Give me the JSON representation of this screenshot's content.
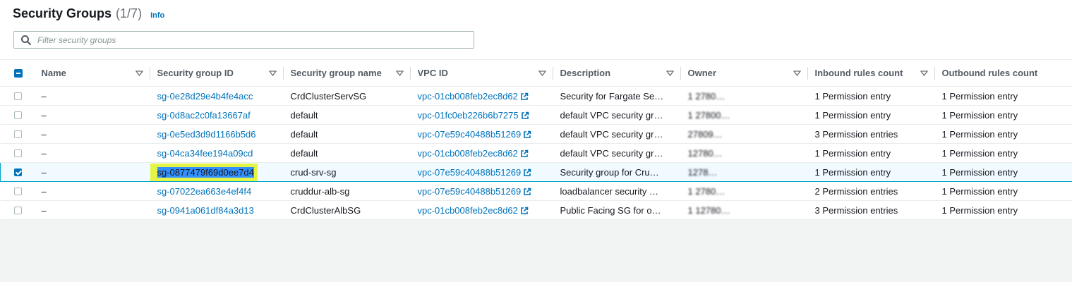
{
  "header": {
    "title": "Security Groups",
    "count": "(1/7)",
    "info": "Info"
  },
  "search": {
    "placeholder": "Filter security groups",
    "value": ""
  },
  "columns": [
    {
      "label": "Name",
      "sortable": true
    },
    {
      "label": "Security group ID",
      "sortable": true
    },
    {
      "label": "Security group name",
      "sortable": true
    },
    {
      "label": "VPC ID",
      "sortable": true
    },
    {
      "label": "Description",
      "sortable": true
    },
    {
      "label": "Owner",
      "sortable": true
    },
    {
      "label": "Inbound rules count",
      "sortable": true
    },
    {
      "label": "Outbound rules count",
      "sortable": false
    }
  ],
  "rows": [
    {
      "selected": false,
      "name": "–",
      "sg_id": "sg-0e28d29e4b4fe4acc",
      "sg_name": "CrdClusterServSG",
      "vpc_id": "vpc-01cb008feb2ec8d62",
      "description": "Security for Fargate Se…",
      "owner": "1   2780…",
      "inbound": "1 Permission entry",
      "outbound": "1 Permission entry"
    },
    {
      "selected": false,
      "name": "–",
      "sg_id": "sg-0d8ac2c0fa13667af",
      "sg_name": "default",
      "vpc_id": "vpc-01fc0eb226b6b7275",
      "description": "default VPC security gr…",
      "owner": "1   27800…",
      "inbound": "1 Permission entry",
      "outbound": "1 Permission entry"
    },
    {
      "selected": false,
      "name": "–",
      "sg_id": "sg-0e5ed3d9d1166b5d6",
      "sg_name": "default",
      "vpc_id": "vpc-07e59c40488b51269",
      "description": "default VPC security gr…",
      "owner": "   27809…",
      "inbound": "3 Permission entries",
      "outbound": "1 Permission entry"
    },
    {
      "selected": false,
      "name": "–",
      "sg_id": "sg-04ca34fee194a09cd",
      "sg_name": "default",
      "vpc_id": "vpc-01cb008feb2ec8d62",
      "description": "default VPC security gr…",
      "owner": "   12780…",
      "inbound": "1 Permission entry",
      "outbound": "1 Permission entry"
    },
    {
      "selected": true,
      "name": "–",
      "sg_id": "sg-0877479f69d0ee7d4",
      "sg_name": "crud-srv-sg",
      "vpc_id": "vpc-07e59c40488b51269",
      "description": "Security group for Cru…",
      "owner": "   1278…",
      "inbound": "1 Permission entry",
      "outbound": "1 Permission entry"
    },
    {
      "selected": false,
      "name": "–",
      "sg_id": "sg-07022ea663e4ef4f4",
      "sg_name": "cruddur-alb-sg",
      "vpc_id": "vpc-07e59c40488b51269",
      "description": "loadbalancer security …",
      "owner": "1   2780…",
      "inbound": "2 Permission entries",
      "outbound": "1 Permission entry"
    },
    {
      "selected": false,
      "name": "–",
      "sg_id": "sg-0941a061df84a3d13",
      "sg_name": "CrdClusterAlbSG",
      "vpc_id": "vpc-01cb008feb2ec8d62",
      "description": "Public Facing SG for o…",
      "owner": "1   12780…",
      "inbound": "3 Permission entries",
      "outbound": "1 Permission entry"
    }
  ],
  "colors": {
    "link": "#0073bb",
    "highlight": "#e5f545",
    "selected_row_border": "#00a1c9"
  }
}
